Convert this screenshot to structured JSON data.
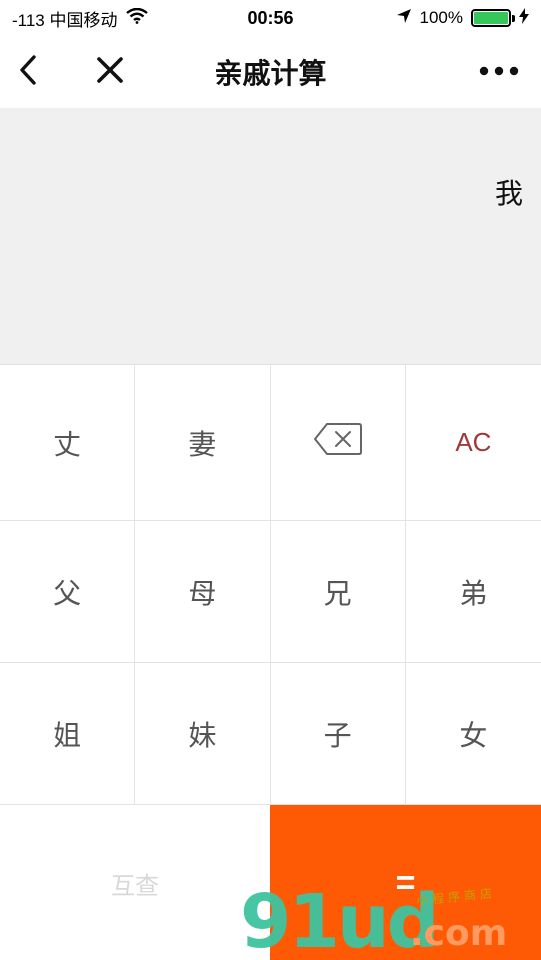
{
  "status_bar": {
    "carrier": "-113 中国移动",
    "time": "00:56",
    "battery": "100%",
    "battery_level": 1.0,
    "icons": [
      "wifi-icon",
      "location-arrow-icon",
      "battery-icon",
      "charging-bolt-icon"
    ]
  },
  "nav": {
    "title": "亲戚计算",
    "back_icon": "chevron-left-icon",
    "close_icon": "close-icon",
    "more_icon": "more-dots-icon"
  },
  "display": {
    "text": "我"
  },
  "keypad": {
    "row1": [
      "丈",
      "妻",
      "",
      "AC"
    ],
    "row2": [
      "父",
      "母",
      "兄",
      "弟"
    ],
    "row3": [
      "姐",
      "妹",
      "子",
      "女"
    ],
    "backspace_icon": "backspace-icon",
    "swap_label": "互查",
    "equals_label": "="
  },
  "watermark": {
    "main": "91ud",
    "dotcom": ".com",
    "sub": "小程序商店"
  },
  "colors": {
    "display_bg": "#eff0ef",
    "equals_bg": "#fe5a06",
    "ac_text": "#a03a3a",
    "battery_green": "#35c759"
  }
}
